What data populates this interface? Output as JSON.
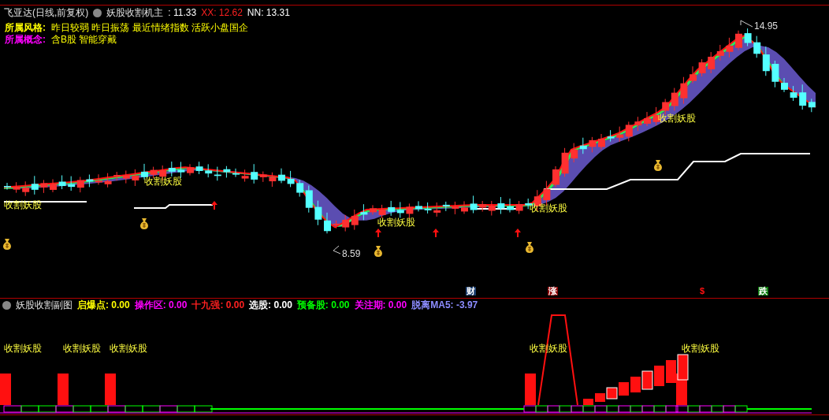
{
  "header": {
    "stock": "飞亚达(日线,前复权)",
    "indicator": "妖股收割机主",
    "values": [
      {
        "text": ": 11.33",
        "color": "#ffffff"
      },
      {
        "text": "XX: 12.62",
        "color": "#ff2020"
      },
      {
        "text": "NN: 13.31",
        "color": "#ffffff"
      }
    ]
  },
  "info_rows": [
    {
      "label": "所属风格:",
      "value": "昨日较弱 昨日振荡 最近情绪指数 活跃小盘国企",
      "color": "#ffff00"
    },
    {
      "label": "所属概念:",
      "value": "含B股 智能穿戴",
      "color": "#ff00ff"
    }
  ],
  "main_chart": {
    "signals": [
      "收割妖股",
      "收割妖股",
      "收割妖股",
      "收割妖股",
      "收割妖股"
    ],
    "price_labels": [
      "8.59",
      "14.95"
    ],
    "event_markers": [
      {
        "text": "财",
        "color": "#1a3d6e"
      },
      {
        "text": "涨",
        "color": "#8b0000"
      },
      {
        "text": "$",
        "color": "#000000"
      },
      {
        "text": "跌",
        "color": "#0a7a0a"
      }
    ]
  },
  "sub_chart": {
    "title": "妖股收割副图",
    "values": [
      {
        "label": "启爆点:",
        "value": "0.00",
        "color": "#ffff00"
      },
      {
        "label": "操作区:",
        "value": "0.00",
        "color": "#ff00ff"
      },
      {
        "label": "十九强:",
        "value": "0.00",
        "color": "#ff2020"
      },
      {
        "label": "选股:",
        "value": "0.00",
        "color": "#ffffff"
      },
      {
        "label": "预备股:",
        "value": "0.00",
        "color": "#00ff00"
      },
      {
        "label": "关注期:",
        "value": "0.00",
        "color": "#ff00ff"
      },
      {
        "label": "脱离MA5:",
        "value": "-3.97",
        "color": "#8c8cff"
      }
    ],
    "signals": [
      "收割妖股",
      "收割妖股",
      "收割妖股",
      "收割妖股",
      "收割妖股"
    ]
  }
}
